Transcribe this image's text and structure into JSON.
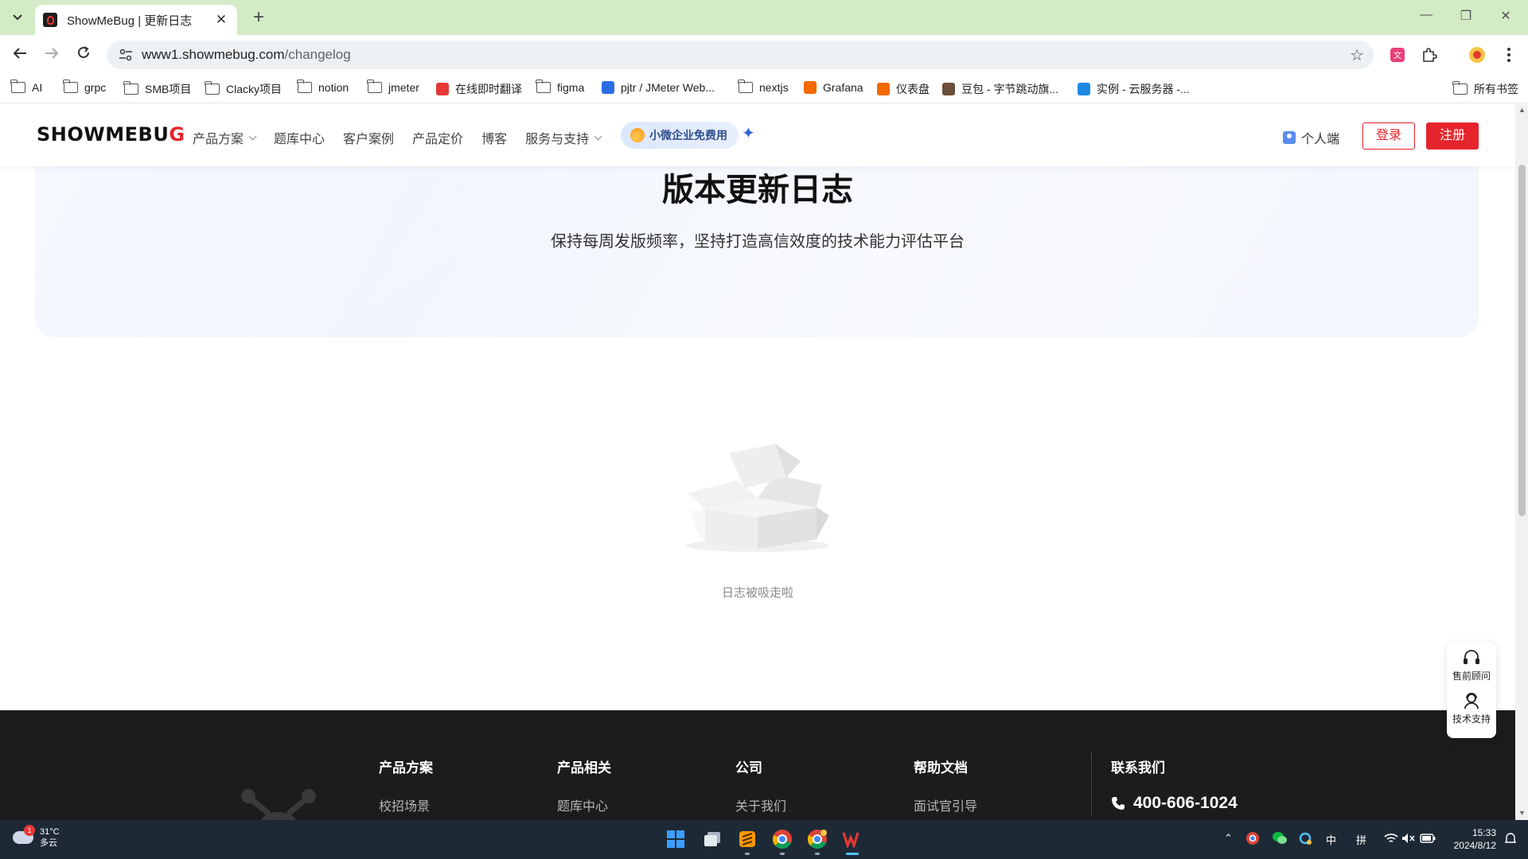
{
  "browser": {
    "tab": {
      "title": "ShowMeBug | 更新日志"
    },
    "url": {
      "host": "www1.showmebug.com",
      "path": "/changelog"
    },
    "bookmarks": [
      {
        "label": "AI",
        "kind": "folder"
      },
      {
        "label": "grpc",
        "kind": "folder"
      },
      {
        "label": "SMB项目",
        "kind": "folder"
      },
      {
        "label": "Clacky项目",
        "kind": "folder"
      },
      {
        "label": "notion",
        "kind": "folder"
      },
      {
        "label": "jmeter",
        "kind": "folder"
      },
      {
        "label": "在线即时翻译",
        "kind": "site",
        "icon": "youdao-icon",
        "color": "#e53935"
      },
      {
        "label": "figma",
        "kind": "folder"
      },
      {
        "label": "pjtr / JMeter Web...",
        "kind": "site",
        "icon": "shield-icon",
        "color": "#2b6de3"
      },
      {
        "label": "nextjs",
        "kind": "folder"
      },
      {
        "label": "Grafana",
        "kind": "site",
        "icon": "grafana-icon",
        "color": "#f46800"
      },
      {
        "label": "仪表盘",
        "kind": "site",
        "icon": "grafana-icon",
        "color": "#f46800"
      },
      {
        "label": "豆包 - 字节跳动旗...",
        "kind": "site",
        "icon": "doubao-icon",
        "color": "#6b4f3a"
      },
      {
        "label": "实例 - 云服务器 -...",
        "kind": "site",
        "icon": "cloud-icon",
        "color": "#1e88e5"
      }
    ],
    "all_bookmarks": "所有书签"
  },
  "site": {
    "logo": {
      "main": "SHOWMEBU",
      "accent": "G"
    },
    "nav": [
      {
        "label": "产品方案",
        "dropdown": true
      },
      {
        "label": "题库中心",
        "dropdown": false
      },
      {
        "label": "客户案例",
        "dropdown": false
      },
      {
        "label": "产品定价",
        "dropdown": false
      },
      {
        "label": "博客",
        "dropdown": false
      },
      {
        "label": "服务与支持",
        "dropdown": true
      }
    ],
    "promo": "小微企业免费用",
    "personal": "个人端",
    "login": "登录",
    "register": "注册"
  },
  "hero": {
    "title": "版本更新日志",
    "subtitle": "保持每周发版频率，坚持打造高信效度的技术能力评估平台"
  },
  "empty_state": {
    "text": "日志被吸走啦"
  },
  "float_support": {
    "presales": "售前顾问",
    "tech": "技术支持"
  },
  "footer": {
    "columns": [
      {
        "heading": "产品方案",
        "links": [
          "校招场景"
        ]
      },
      {
        "heading": "产品相关",
        "links": [
          "题库中心"
        ]
      },
      {
        "heading": "公司",
        "links": [
          "关于我们"
        ]
      },
      {
        "heading": "帮助文档",
        "links": [
          "面试官引导"
        ]
      }
    ],
    "contact": {
      "heading": "联系我们",
      "phone": "400-606-1024"
    }
  },
  "taskbar": {
    "weather": {
      "temp": "31°C",
      "desc": "多云",
      "badge": "1"
    },
    "ime1": "中",
    "ime2": "拼",
    "time": "15:33",
    "date": "2024/8/12"
  },
  "colors": {
    "brand_red": "#e5242b",
    "tabstrip": "#d3ebc6",
    "footer_bg": "#1c1c1e"
  }
}
